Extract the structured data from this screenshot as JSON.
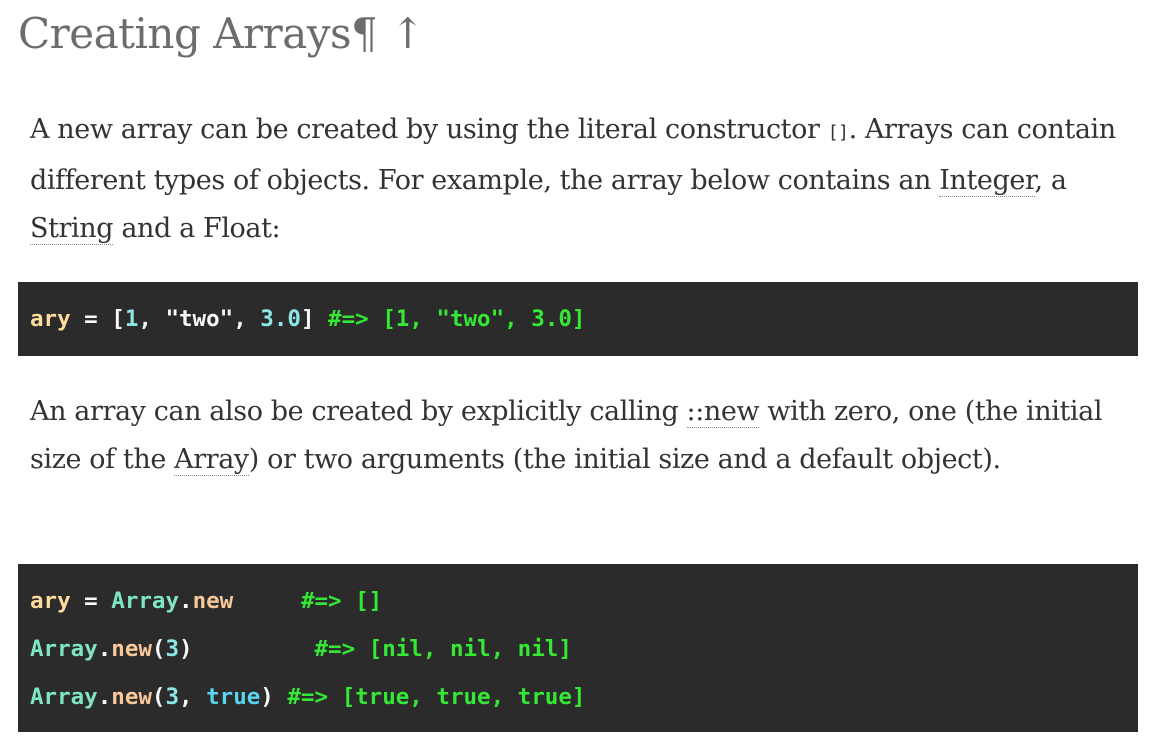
{
  "heading": {
    "title": "Creating Arrays",
    "pilcrow": "¶",
    "up_arrow": "↑"
  },
  "para1": {
    "t1": "A new array can be created by using the literal constructor ",
    "code1": "[]",
    "t2": ". Arrays can contain different types of objects. For example, the array below contains an ",
    "link_integer": "Integer",
    "t3": ", a ",
    "link_string": "String",
    "t4": " and a Float:"
  },
  "code1": {
    "line1": {
      "var": "ary",
      "op_eq": " = ",
      "open": "[",
      "num1": "1",
      "comma1": ", ",
      "str": "\"two\"",
      "comma2": ", ",
      "num2": "3.0",
      "close": "] ",
      "comment": "#=> [1, \"two\", 3.0]"
    }
  },
  "para2": {
    "t1": "An array can also be created by explicitly calling ",
    "link_new": "::new",
    "t2": " with zero, one (the initial size of the ",
    "link_array": "Array",
    "t3": ") or two arguments (the initial size and a default object)."
  },
  "code2": {
    "line1": {
      "var": "ary",
      "op_eq": " = ",
      "const": "Array",
      "dot": ".",
      "method": "new",
      "pad": "     ",
      "comment": "#=> []"
    },
    "line2": {
      "const": "Array",
      "dot": ".",
      "method": "new",
      "open": "(",
      "num": "3",
      "close": ")",
      "pad": "         ",
      "comment": "#=> [nil, nil, nil]"
    },
    "line3": {
      "const": "Array",
      "dot": ".",
      "method": "new",
      "open": "(",
      "num": "3",
      "comma": ", ",
      "kw": "true",
      "close": ")",
      "pad": " ",
      "comment": "#=> [true, true, true]"
    }
  }
}
